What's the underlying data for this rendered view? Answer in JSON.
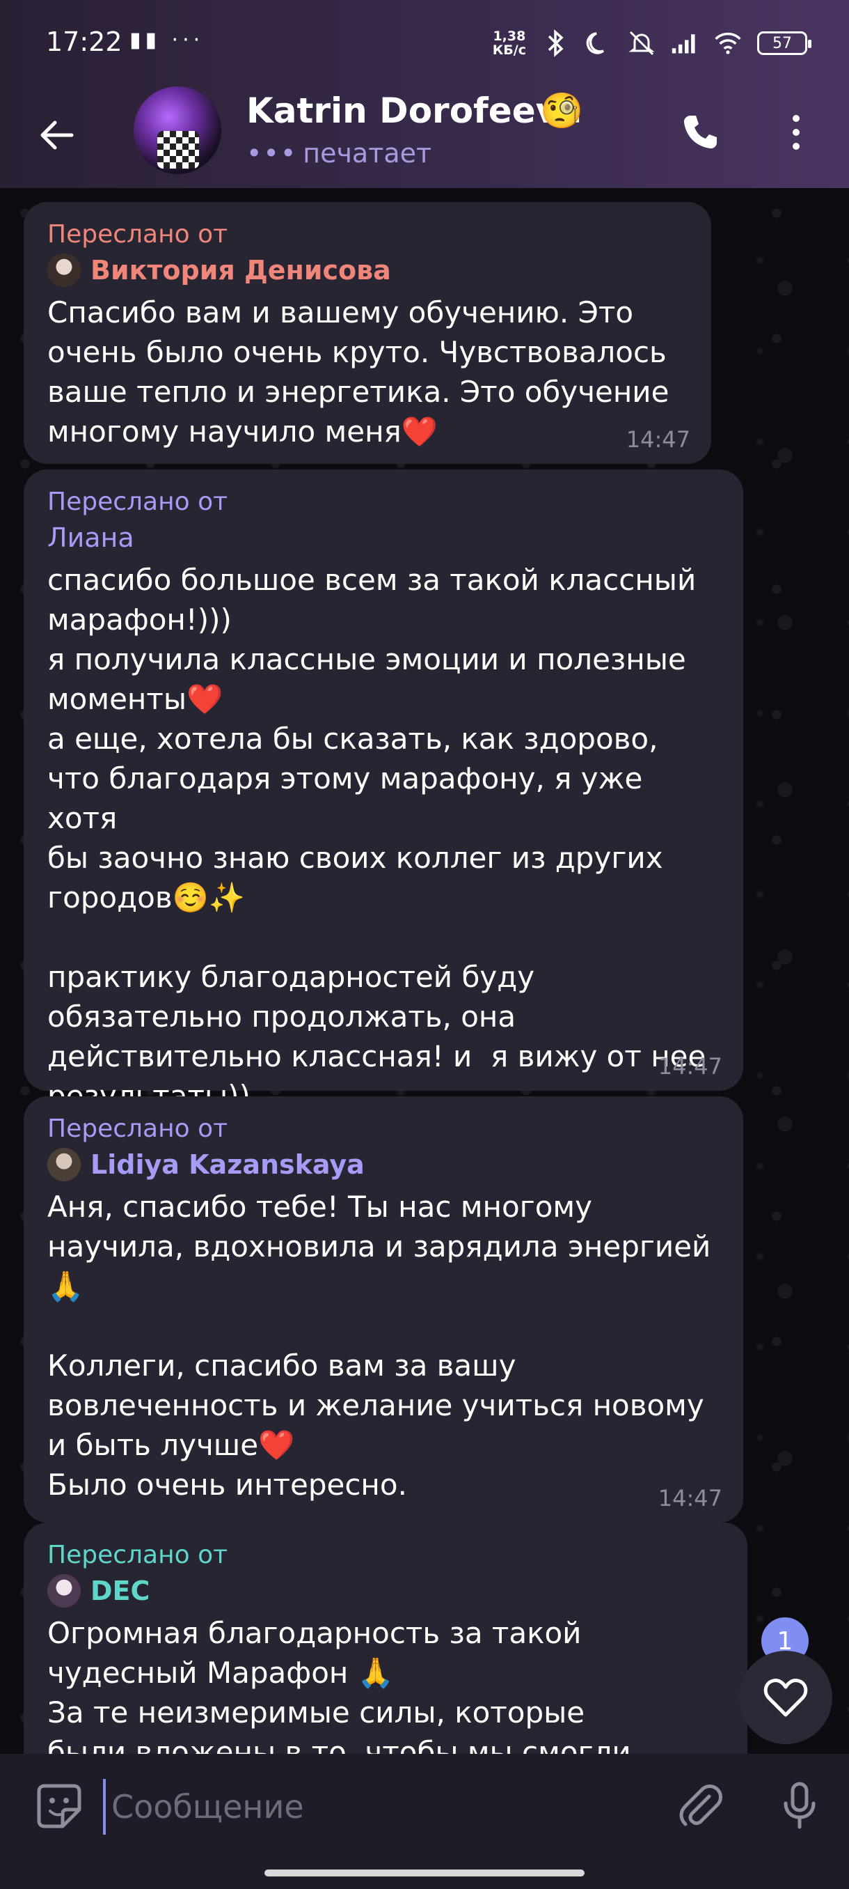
{
  "status_bar": {
    "time": "17:22",
    "left_icons": "▮▮ ···",
    "net_speed_value": "1,38",
    "net_speed_unit": "КБ/с",
    "battery": "57"
  },
  "header": {
    "contact_name": "Katrin Dorofeeva",
    "contact_emoji": "🧐",
    "status": "печатает",
    "status_dots": "•••"
  },
  "messages": [
    {
      "forwarded_label": "Переслано от",
      "author": "Виктория Денисова",
      "author_color": "#f0867a",
      "label_color": "#f0867a",
      "text": "Спасибо вам и вашему обучению. Это\nочень было очень круто. Чувствовалось\nваше тепло и энергетика. Это обучение\nмногому научило меня❤️",
      "time": "14:47"
    },
    {
      "forwarded_label": "Переслано от",
      "author": "Лиана",
      "author_color": "#a59cf5",
      "label_color": "#a59cf5",
      "text": "спасибо большое всем за такой классный\nмарафон!)))\nя получила классные эмоции и полезные\nмоменты❤️\nа еще, хотела бы сказать, как здорово,\nчто благодаря этому марафону, я уже хотя\nбы заочно знаю своих коллег из других\nгородов☺️✨\n\nпрактику благодарностей буду\nобязательно продолжать, она\nдействительно классная! и  я вижу от нее\nрезультаты))",
      "time": "14:47"
    },
    {
      "forwarded_label": "Переслано от",
      "author": "Lidiya Kazanskaya",
      "author_color": "#a59cf5",
      "label_color": "#a59cf5",
      "text": "Аня, спасибо тебе! Ты нас многому\nнаучила, вдохновила и зарядила энергией\n🙏\n\nКоллеги, спасибо вам за вашу\nвовлеченность и желание учиться новому\nи быть лучше❤️\nБыло очень интересно.",
      "time": "14:47"
    },
    {
      "forwarded_label": "Переслано от",
      "author": "DEC",
      "author_color": "#5fd6c9",
      "label_color": "#5fd6c9",
      "text": "Огромная благодарность за такой\nчудесный Марафон 🙏\nЗа те неизмеримые силы, которые\nбыли вложены в то, чтобы мы смогли",
      "time": ""
    }
  ],
  "reaction": {
    "count": "1"
  },
  "input": {
    "placeholder": "Сообщение",
    "value": ""
  },
  "colors": {
    "accent": "#7f8ef0",
    "bubble": "#272532",
    "header": "#3a2b4e"
  }
}
